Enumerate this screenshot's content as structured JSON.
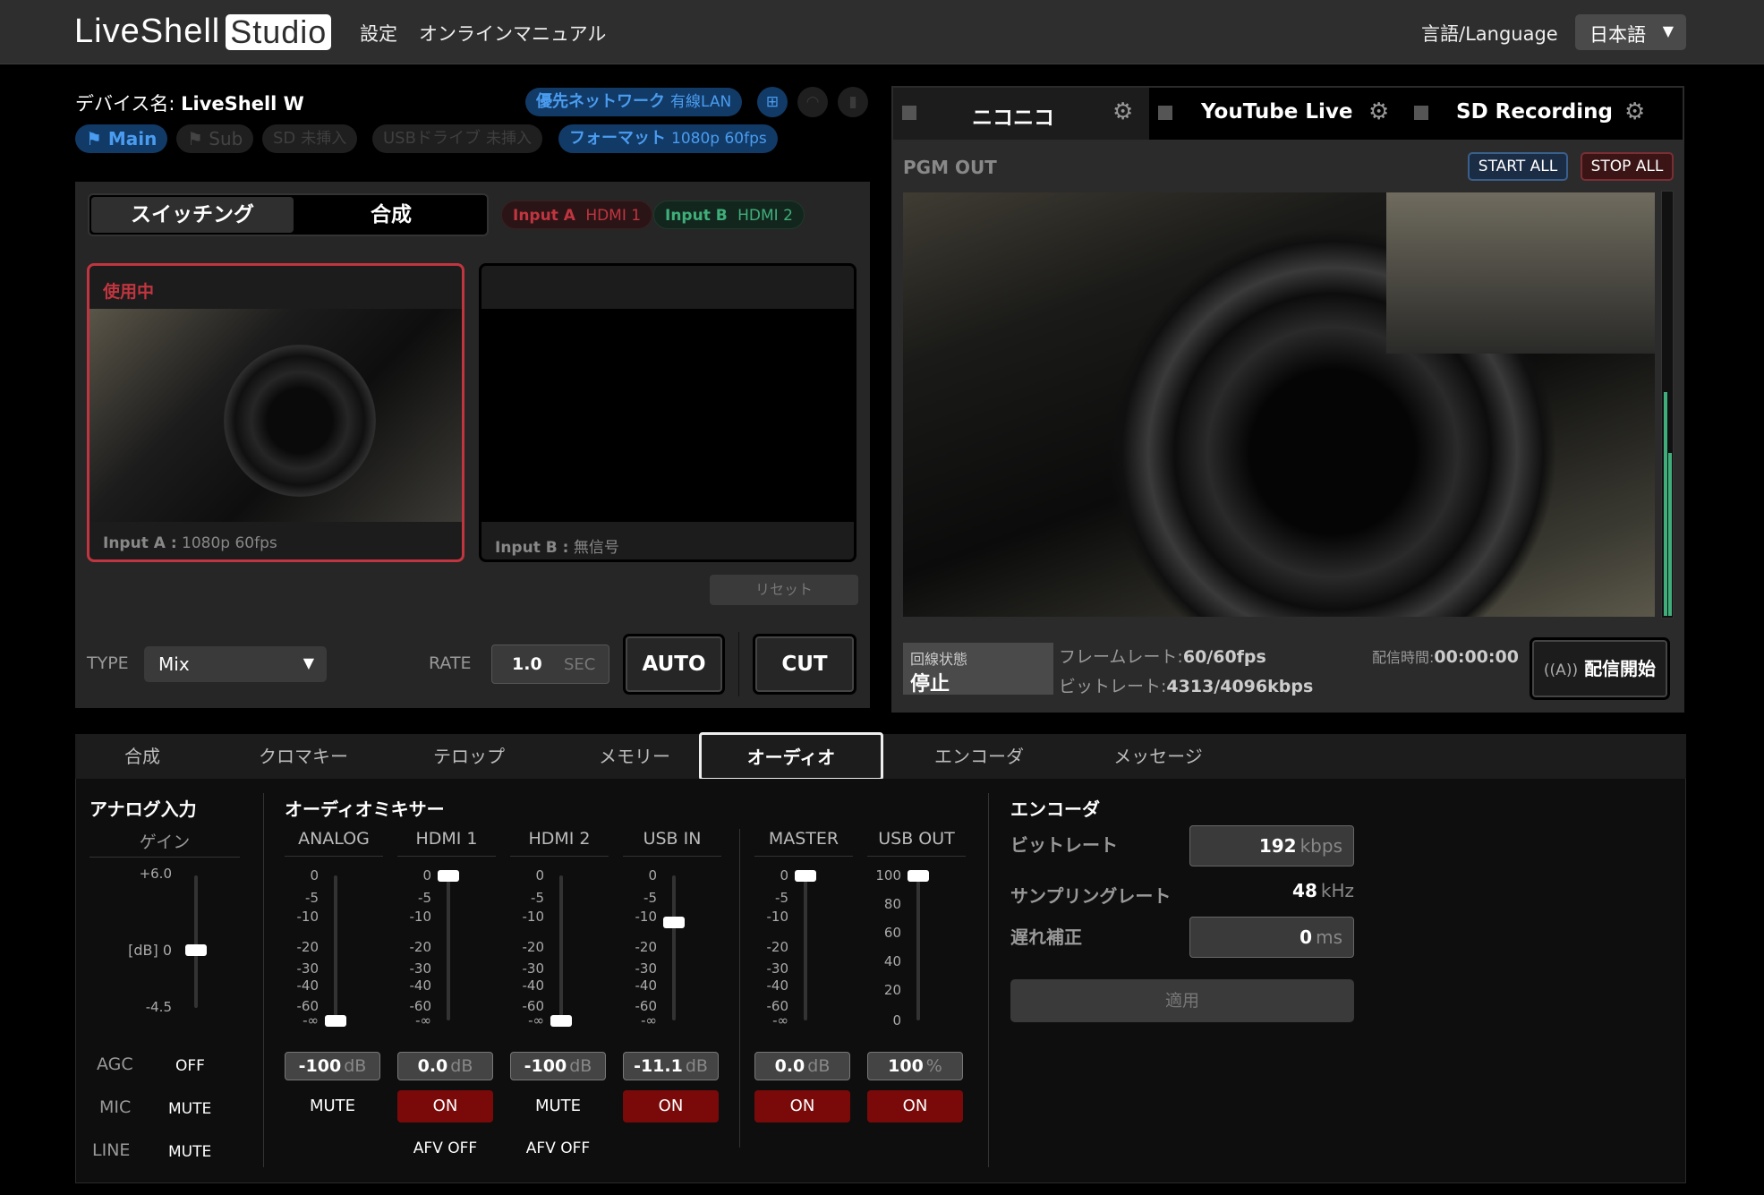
{
  "header": {
    "logo_main": "LiveShell",
    "logo_box": "Studio",
    "nav_settings": "設定",
    "nav_manual": "オンラインマニュアル",
    "lang_label": "言語/Language",
    "lang_value": "日本語"
  },
  "device": {
    "name_label": "デバイス名:",
    "name": "LiveShell W",
    "network_label": "優先ネットワーク",
    "network_value": "有線LAN",
    "main_chip": "Main",
    "sub_chip": "Sub",
    "sd_label": "SD",
    "sd_value": "未挿入",
    "usb_label": "USBドライブ",
    "usb_value": "未挿入",
    "format_label": "フォーマット",
    "format_value": "1080p 60fps"
  },
  "switcher": {
    "tab_switching": "スイッチング",
    "tab_compose": "合成",
    "input_a_tag": "Input A",
    "input_a_src": "HDMI 1",
    "input_b_tag": "Input B",
    "input_b_src": "HDMI 2",
    "card_a_status": "使用中",
    "card_a_caption_label": "Input A :",
    "card_a_caption": "1080p 60fps",
    "card_b_caption_label": "Input B :",
    "card_b_caption": "無信号",
    "reset_label": "リセット",
    "type_label": "TYPE",
    "type_value": "Mix",
    "rate_label": "RATE",
    "rate_value": "1.0",
    "rate_unit": "SEC",
    "auto_label": "AUTO",
    "cut_label": "CUT"
  },
  "output": {
    "tabs": [
      {
        "label": "ニコニコ"
      },
      {
        "label": "YouTube Live"
      },
      {
        "label": "SD Recording"
      }
    ],
    "pgm_label": "PGM OUT",
    "start_all": "START ALL",
    "stop_all": "STOP ALL",
    "status_label": "回線状態",
    "status_value": "停止",
    "framerate_label": "フレームレート:",
    "framerate_value": "60/60fps",
    "bitrate_label": "ビットレート:",
    "bitrate_value": "4313/4096kbps",
    "time_label": "配信時間:",
    "time_value": "00:00:00",
    "start_stream": "配信開始"
  },
  "bottom_tabs": [
    {
      "label": "合成"
    },
    {
      "label": "クロマキー"
    },
    {
      "label": "テロップ"
    },
    {
      "label": "メモリー"
    },
    {
      "label": "オーディオ"
    },
    {
      "label": "エンコーダ"
    },
    {
      "label": "メッセージ"
    }
  ],
  "analog": {
    "title": "アナログ入力",
    "gain_label": "ゲイン",
    "gain_top": "+6.0",
    "gain_mid": "[dB] 0",
    "gain_bottom": "-4.5",
    "agc_label": "AGC",
    "agc_value": "OFF",
    "mic_label": "MIC",
    "mic_value": "MUTE",
    "line_label": "LINE",
    "line_value": "MUTE"
  },
  "mixer": {
    "title": "オーディオミキサー",
    "db_ticks": [
      "0",
      "-5",
      "-10",
      "-20",
      "-30",
      "-40",
      "-60",
      "-∞"
    ],
    "pct_ticks": [
      "100",
      "80",
      "60",
      "40",
      "20",
      "0"
    ],
    "channels": [
      {
        "name": "ANALOG",
        "level": 0.0,
        "value": "-100",
        "unit": "dB",
        "toggle": "MUTE",
        "toggle_on": false,
        "afv": ""
      },
      {
        "name": "HDMI 1",
        "level": 1.0,
        "value": "0.0",
        "unit": "dB",
        "toggle": "ON",
        "toggle_on": true,
        "afv": "AFV OFF"
      },
      {
        "name": "HDMI 2",
        "level": 0.0,
        "value": "-100",
        "unit": "dB",
        "toggle": "MUTE",
        "toggle_on": false,
        "afv": "AFV OFF"
      },
      {
        "name": "USB IN",
        "level": 0.68,
        "value": "-11.1",
        "unit": "dB",
        "toggle": "ON",
        "toggle_on": true,
        "afv": ""
      },
      {
        "name": "MASTER",
        "level": 1.0,
        "value": "0.0",
        "unit": "dB",
        "toggle": "ON",
        "toggle_on": true,
        "afv": ""
      },
      {
        "name": "USB OUT",
        "level": 1.0,
        "value": "100",
        "unit": "%",
        "toggle": "ON",
        "toggle_on": true,
        "afv": ""
      }
    ]
  },
  "encoder": {
    "title": "エンコーダ",
    "bitrate_label": "ビットレート",
    "bitrate_value": "192",
    "bitrate_unit": "kbps",
    "samplerate_label": "サンプリングレート",
    "samplerate_value": "48",
    "samplerate_unit": "kHz",
    "delay_label": "遅れ補正",
    "delay_value": "0",
    "delay_unit": "ms",
    "apply_label": "適用"
  },
  "colors": {
    "accent_blue": "#4a9cf0",
    "active_red": "#c0353f",
    "on_red": "#7a0a0a",
    "input_b_green": "#3fae7a"
  }
}
